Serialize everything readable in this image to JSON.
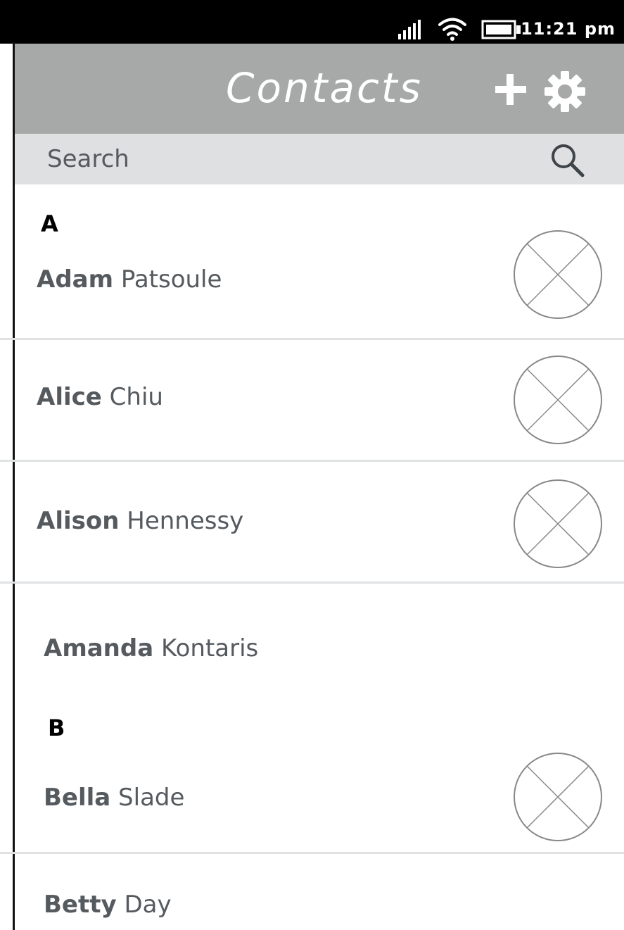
{
  "status_bar": {
    "time": "11:21 pm",
    "icons": [
      "signal-icon",
      "wifi-icon",
      "battery-icon"
    ]
  },
  "header": {
    "title": "Contacts",
    "add_icon": "plus-icon",
    "settings_icon": "gear-icon",
    "background": "#a6a9a7"
  },
  "search": {
    "placeholder": "Search",
    "icon": "search-icon",
    "background": "#dfe0e1"
  },
  "sections": [
    {
      "letter": "A",
      "contacts": [
        {
          "first": "Adam",
          "last": "Patsoule",
          "avatar": "avatar-placeholder-icon"
        },
        {
          "first": "Alice",
          "last": "Chiu",
          "avatar": "avatar-placeholder-icon"
        },
        {
          "first": "Alison",
          "last": "Hennessy",
          "avatar": "avatar-placeholder-icon"
        },
        {
          "first": "Amanda",
          "last": "Kontaris",
          "avatar": null
        }
      ]
    },
    {
      "letter": "B",
      "contacts": [
        {
          "first": "Bella",
          "last": "Slade",
          "avatar": "avatar-placeholder-icon"
        },
        {
          "first": "Betty",
          "last": "Day",
          "avatar": null
        }
      ]
    }
  ],
  "colors": {
    "text": "#555a5f",
    "divider": "#e0e2e4",
    "avatar_stroke": "#888888"
  }
}
